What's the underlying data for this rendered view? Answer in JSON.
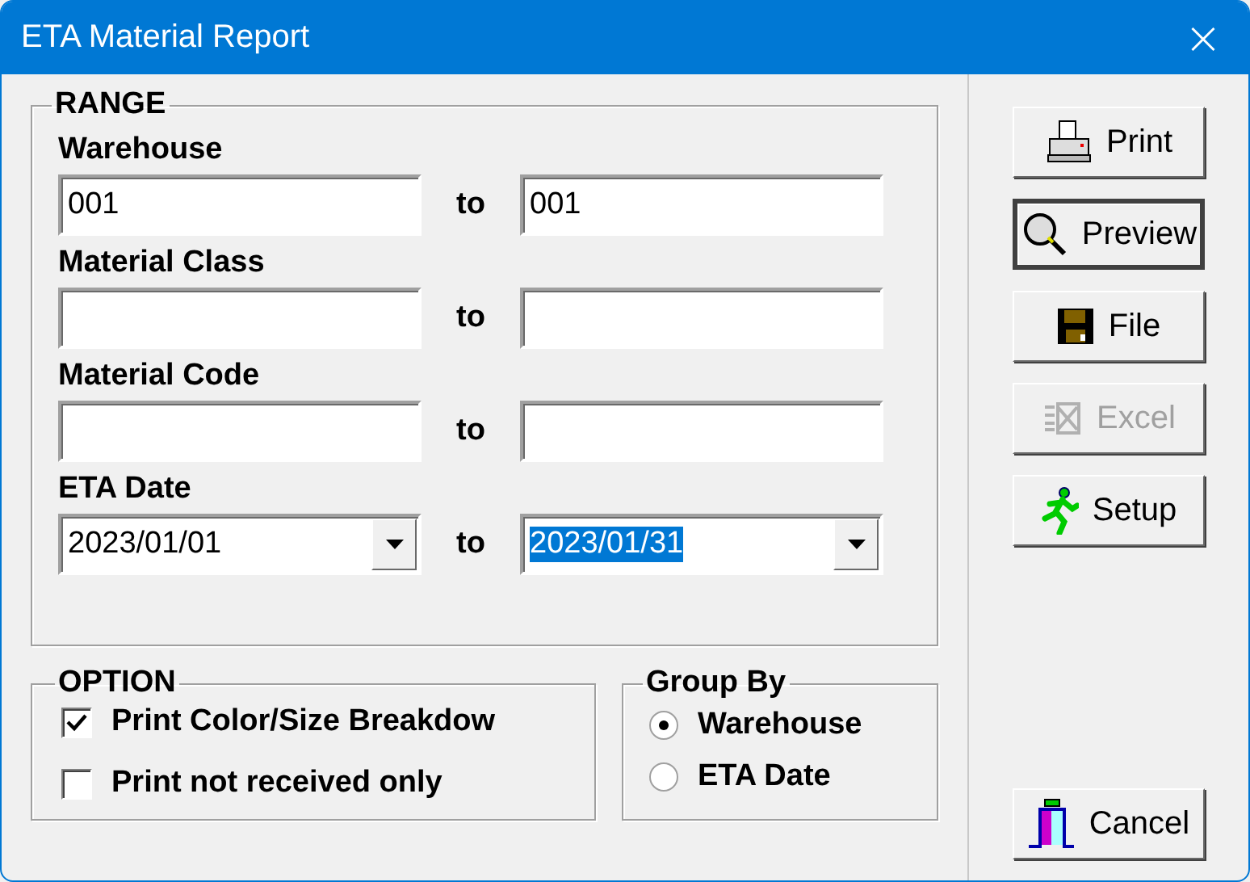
{
  "window": {
    "title": "ETA Material Report",
    "close": "×"
  },
  "range": {
    "title": "RANGE",
    "rows": [
      {
        "label": "Warehouse",
        "kind": "text",
        "from": {
          "value": "001",
          "highlighted": false
        },
        "to_label": "to",
        "to": {
          "value": "001",
          "highlighted": false
        }
      },
      {
        "label": "Material Class",
        "kind": "text",
        "to_label": "to"
      },
      {
        "label": "Material Code",
        "kind": "text",
        "to_label": "to"
      },
      {
        "label": "ETA Date",
        "kind": "dropdown",
        "from": {
          "value": "2023/01/01",
          "highlighted": false
        },
        "to_label": "to",
        "to": {
          "value": "2023/01/31",
          "highlighted": true
        }
      }
    ]
  },
  "option": {
    "title": "OPTION",
    "items": [
      {
        "label": "Print Color/Size Breakdow",
        "checked": true
      },
      {
        "label": "Print not received only",
        "checked": false
      }
    ]
  },
  "group_by": {
    "title": "Group By",
    "items": [
      {
        "label": "Warehouse",
        "selected": true
      },
      {
        "label": "ETA Date",
        "selected": false
      }
    ]
  },
  "buttons": [
    {
      "label": "Print",
      "kind": "print",
      "disabled": false,
      "default": false
    },
    {
      "label": "Preview",
      "kind": "preview",
      "disabled": false,
      "default": true
    },
    {
      "label": "File",
      "kind": "file",
      "disabled": false,
      "default": false
    },
    {
      "label": "Excel",
      "kind": "excel",
      "disabled": true,
      "default": false
    },
    {
      "label": "Setup",
      "kind": "setup",
      "disabled": false,
      "default": false
    }
  ],
  "cancel": {
    "label": "Cancel",
    "kind": "cancel",
    "disabled": false,
    "default": false
  }
}
